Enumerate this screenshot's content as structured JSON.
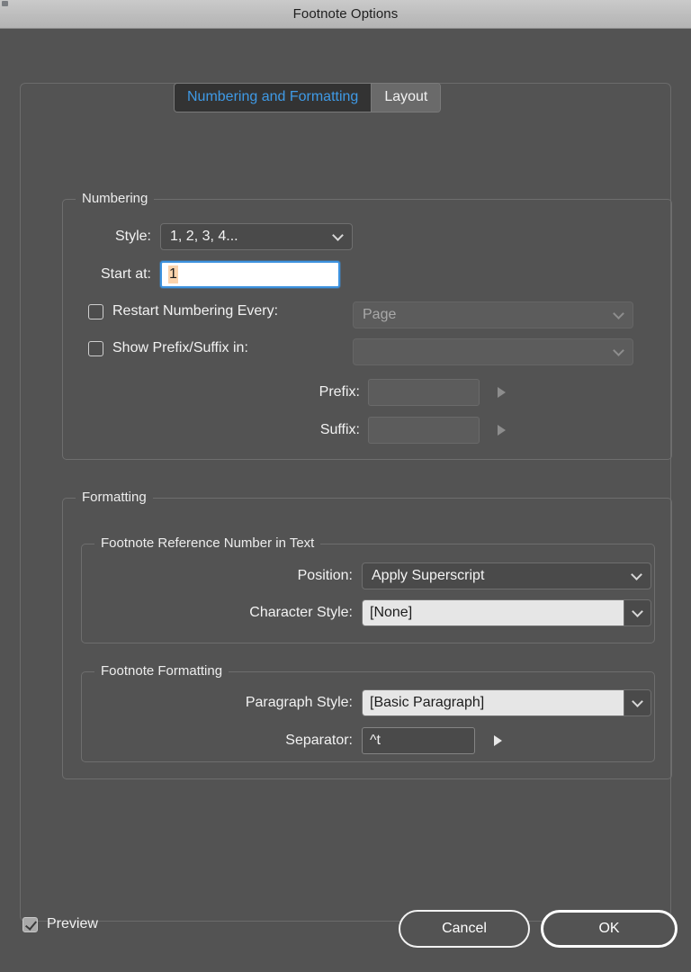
{
  "window": {
    "title": "Footnote Options"
  },
  "tabs": [
    {
      "label": "Numbering and Formatting",
      "active": true
    },
    {
      "label": "Layout",
      "active": false
    }
  ],
  "numbering": {
    "legend": "Numbering",
    "style": {
      "label": "Style:",
      "value": "1, 2, 3, 4..."
    },
    "start_at": {
      "label": "Start at:",
      "value": "1"
    },
    "restart": {
      "label": "Restart Numbering Every:",
      "checked": false,
      "value": "Page"
    },
    "show_prefix_suffix": {
      "label": "Show Prefix/Suffix in:",
      "checked": false,
      "value": ""
    },
    "prefix": {
      "label": "Prefix:",
      "value": ""
    },
    "suffix": {
      "label": "Suffix:",
      "value": ""
    }
  },
  "formatting": {
    "legend": "Formatting",
    "reference_number": {
      "legend": "Footnote Reference Number in Text",
      "position": {
        "label": "Position:",
        "value": "Apply Superscript"
      },
      "character_style": {
        "label": "Character Style:",
        "value": "[None]"
      }
    },
    "footnote_formatting": {
      "legend": "Footnote Formatting",
      "paragraph_style": {
        "label": "Paragraph Style:",
        "value": "[Basic Paragraph]"
      },
      "separator": {
        "label": "Separator:",
        "value": "^t"
      }
    }
  },
  "footer": {
    "preview": {
      "label": "Preview",
      "checked": true
    },
    "cancel_label": "Cancel",
    "ok_label": "OK"
  },
  "colors": {
    "dialog_bg": "#535353",
    "titlebar_bg": "#bdbdbd",
    "active_tab_bg": "#333333",
    "active_tab_text": "#3f9ae6",
    "focus_border": "#3d93e0",
    "text_selection": "#fbd4ad",
    "field_light_bg": "#e6e6e6"
  }
}
